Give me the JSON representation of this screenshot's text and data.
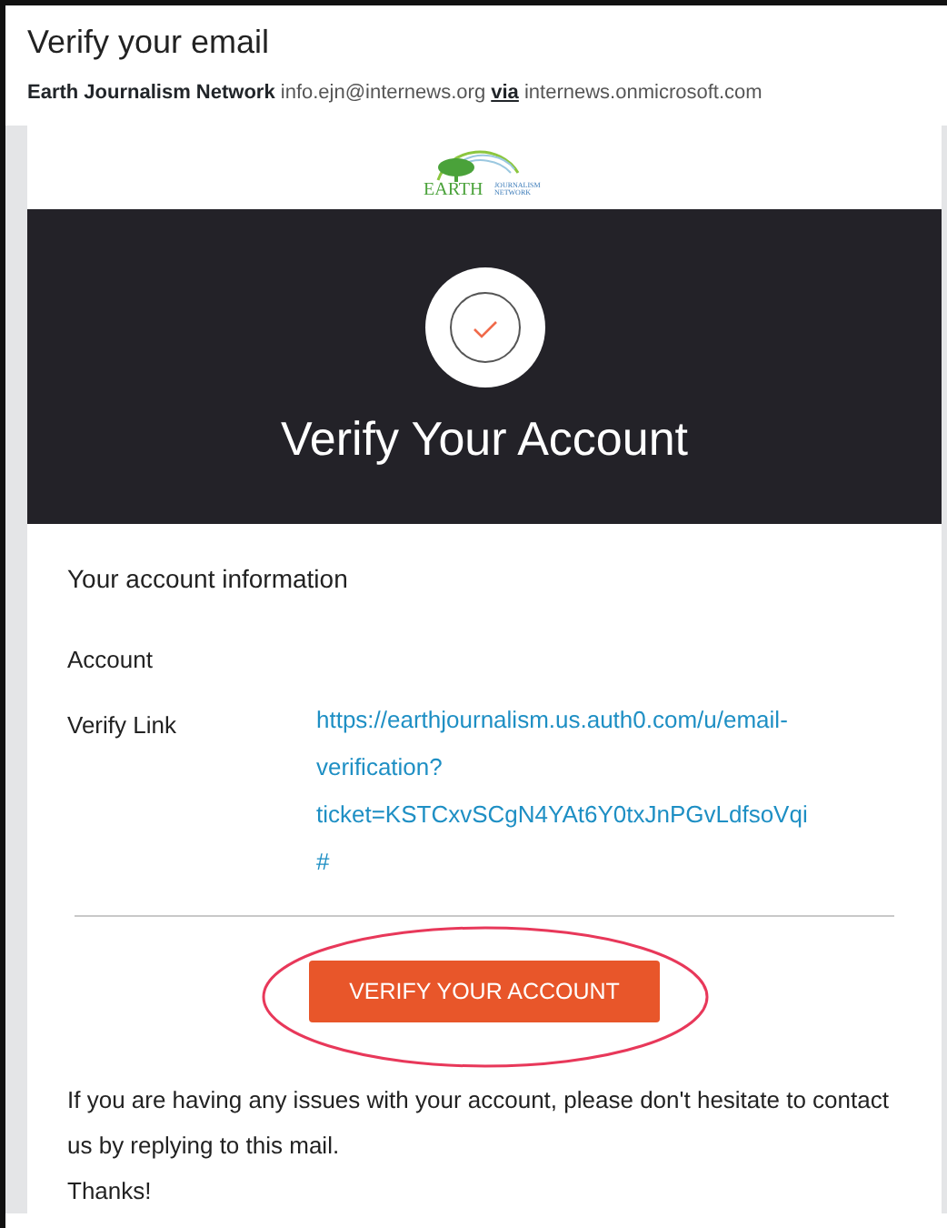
{
  "subject": "Verify your email",
  "sender": {
    "name": "Earth Journalism Network",
    "email": "info.ejn@internews.org",
    "via": "via",
    "domain": "internews.onmicrosoft.com"
  },
  "logo": {
    "word": "EARTH",
    "tagline_1": "JOURNALISM",
    "tagline_2": "NETWORK"
  },
  "hero": {
    "title": "Verify Your Account"
  },
  "info": {
    "heading": "Your account information",
    "rows": [
      {
        "label": "Account",
        "value": ""
      },
      {
        "label": "Verify Link",
        "value": "https://earthjournalism.us.auth0.com/u/email-verification?ticket=KSTCxvSCgN4YAt6Y0txJnPGvLdfsoVqi#",
        "kind": "link"
      }
    ]
  },
  "button": {
    "label": "VERIFY YOUR ACCOUNT",
    "highlighted": true
  },
  "message": {
    "text": "If you are having any issues with your account, please don't hesitate to contact us by replying to this mail.",
    "closing": "Thanks!"
  }
}
